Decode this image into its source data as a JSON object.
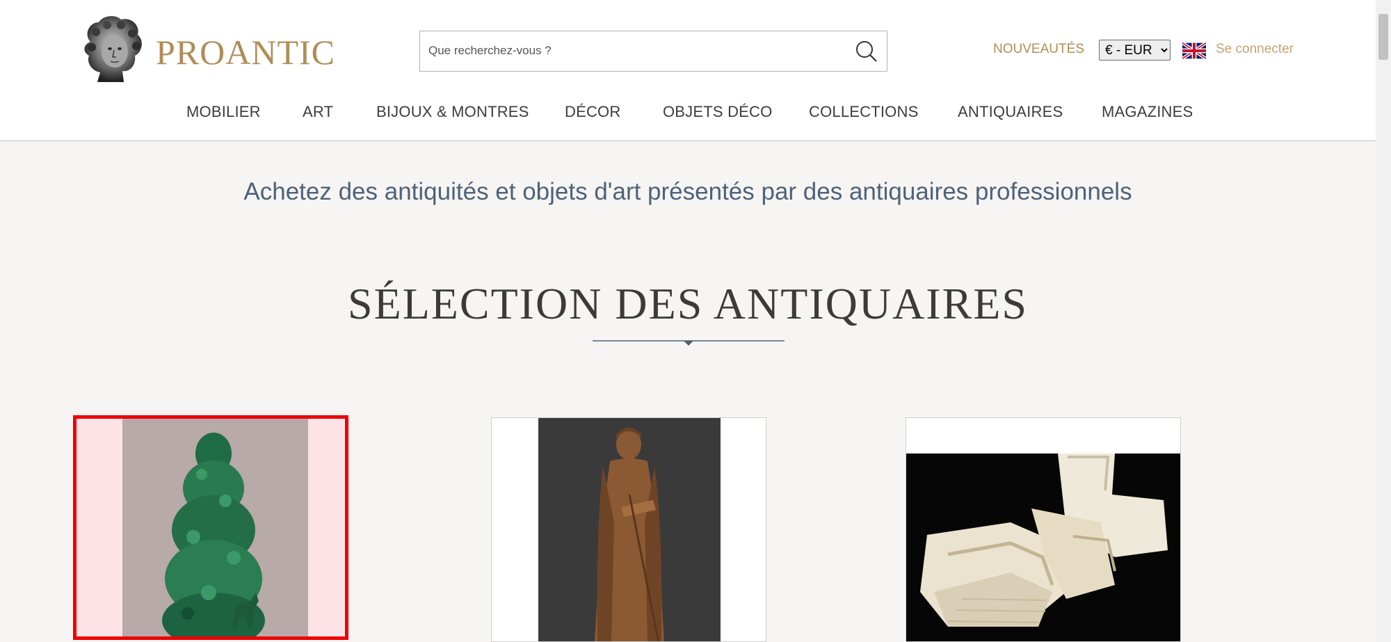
{
  "header": {
    "brand": "PROANTIC",
    "search": {
      "placeholder": "Que recherchez-vous ?"
    },
    "news_link": "NOUVEAUTÉS",
    "currency": {
      "selected": "€ - EUR"
    },
    "language_icon": "uk-flag-icon",
    "login_link": "Se connecter"
  },
  "nav": {
    "items": [
      {
        "label": "MOBILIER"
      },
      {
        "label": "ART"
      },
      {
        "label": "BIJOUX & MONTRES"
      },
      {
        "label": "DÉCOR"
      },
      {
        "label": "OBJETS DÉCO"
      },
      {
        "label": "COLLECTIONS"
      },
      {
        "label": "ANTIQUAIRES"
      },
      {
        "label": "MAGAZINES"
      }
    ]
  },
  "main": {
    "tagline": "Achetez des antiquités et objets d'art présentés par des antiquaires professionnels",
    "section_title": "SÉLECTION DES ANTIQUAIRES",
    "cards": [
      {
        "image": "green-majolica-tree-sculpture",
        "selected": true
      },
      {
        "image": "carved-wood-saint-statue",
        "selected": false
      },
      {
        "image": "embroidered-lace-linens",
        "selected": false
      }
    ]
  },
  "colors": {
    "brand_gold": "#b08d57",
    "tagline_blue": "#4e6279",
    "selection_red": "#ee0000"
  }
}
